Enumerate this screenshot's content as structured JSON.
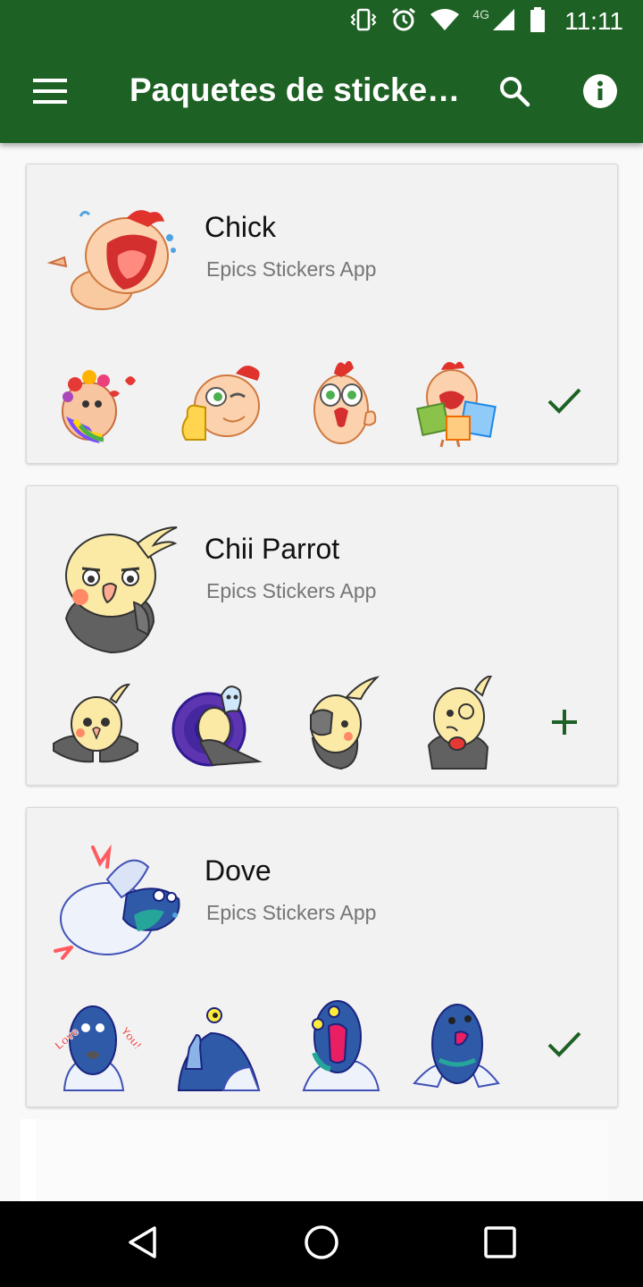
{
  "status_bar": {
    "time": "11:11",
    "network_label": "4G",
    "icons": [
      "vibrate-icon",
      "alarm-icon",
      "wifi-icon",
      "signal-icon",
      "battery-icon"
    ]
  },
  "app_bar": {
    "title": "Paquetes de sticke…",
    "menu_icon": "menu-icon",
    "search_icon": "search-icon",
    "info_icon": "info-icon"
  },
  "colors": {
    "primary": "#1e6124",
    "card_background": "#f2f2f2",
    "publisher_text": "#757575",
    "action": "#1e6124"
  },
  "sticker_packs": [
    {
      "name": "Chick",
      "publisher": "Epics Stickers App",
      "tray_icon": "chick-laughing-sticker",
      "previews": [
        "chick-flowers-heart-sticker",
        "chick-thumbs-up-sticker",
        "chick-shocked-sticker",
        "chick-shopping-bags-sticker"
      ],
      "action": "added",
      "action_icon": "check-icon"
    },
    {
      "name": "Chii Parrot",
      "publisher": "Epics Stickers App",
      "tray_icon": "parrot-annoyed-sticker",
      "previews": [
        "parrot-shrug-sticker",
        "parrot-ghost-sticker",
        "parrot-facepalm-sticker",
        "parrot-coffee-sticker"
      ],
      "action": "add",
      "action_icon": "plus-icon"
    },
    {
      "name": "Dove",
      "publisher": "Epics Stickers App",
      "tray_icon": "dove-lying-sticker",
      "previews": [
        "dove-love-you-sticker",
        "dove-thumbs-up-sticker",
        "dove-screaming-sticker",
        "dove-happy-sticker"
      ],
      "action": "added",
      "action_icon": "check-icon"
    }
  ],
  "love_sticker_text": [
    "Love",
    "You!"
  ],
  "navigation_bar": {
    "buttons": [
      "back-icon",
      "home-icon",
      "recents-icon"
    ]
  }
}
